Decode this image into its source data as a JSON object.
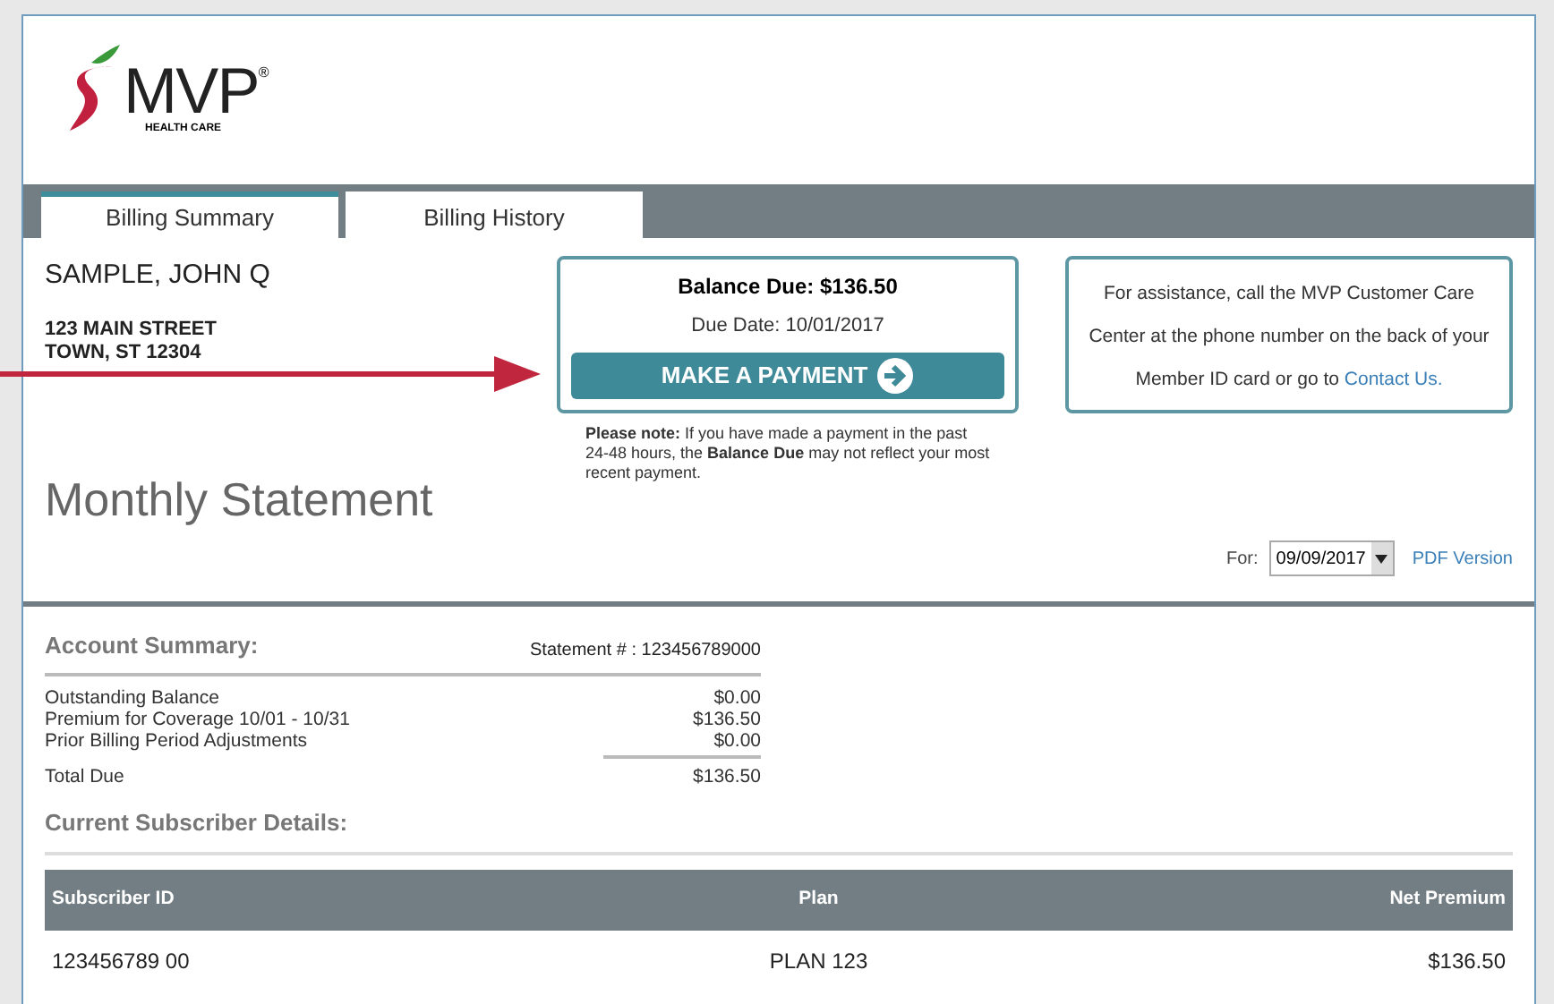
{
  "logo": {
    "name": "MVP",
    "tagline": "HEALTH CARE",
    "mark": "®"
  },
  "tabs": [
    {
      "label": "Billing Summary",
      "selected": true
    },
    {
      "label": "Billing History",
      "selected": false
    }
  ],
  "member": {
    "name": "SAMPLE, JOHN Q",
    "address": [
      "123 MAIN STREET",
      "TOWN, ST 12304"
    ]
  },
  "balance": {
    "title": "Balance Due: $136.50",
    "due_date": "Due Date: 10/01/2017",
    "button": "MAKE A PAYMENT",
    "note": "**Please note:** If you have made a payment in the past 24-48 hours, the **Balance Due** may not reflect your most recent payment."
  },
  "assistance": {
    "text": "For assistance, call the MVP Customer Care Center at the phone number on the back of your Member ID card or go to",
    "link": "Contact Us."
  },
  "page_title": "Monthly Statement",
  "statement_select": {
    "label": "For:",
    "value": "09/09/2017",
    "link": "PDF Version"
  },
  "account_summary": {
    "heading": "Account Summary:",
    "statement_number": "Statement # : 123456789000",
    "lines": [
      {
        "label": "Outstanding Balance",
        "amount": "$0.00"
      },
      {
        "label": "Premium for Coverage 10/01 - 10/31",
        "amount": "$136.50"
      },
      {
        "label": "Prior Billing Period Adjustments",
        "amount": "$0.00"
      }
    ],
    "total": {
      "label": "Total Due",
      "amount": "$136.50"
    }
  },
  "subscriber_details": {
    "heading": "Current Subscriber Details:",
    "columns": [
      "Subscriber ID",
      "Plan",
      "Net Premium"
    ],
    "rows": [
      [
        "123456789 00",
        "PLAN 123",
        "$136.50"
      ]
    ]
  }
}
